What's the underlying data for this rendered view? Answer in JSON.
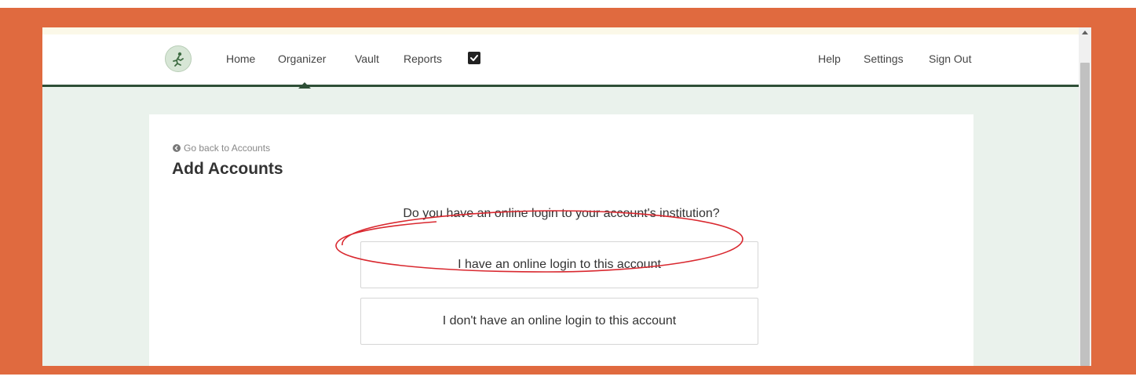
{
  "nav": {
    "left_items": [
      "Home",
      "Organizer",
      "Vault",
      "Reports"
    ],
    "right_items": [
      "Help",
      "Settings",
      "Sign Out"
    ],
    "active_item": "Organizer",
    "tasks_icon": "checkbox-icon",
    "logo_icon": "runner-logo-icon"
  },
  "page": {
    "back_link": "Go back to Accounts",
    "title": "Add Accounts",
    "question": "Do you have an online login to your account's institution?"
  },
  "options": {
    "has_login": "I have an online login to this account",
    "no_login": "I don't have an online login to this account"
  },
  "colors": {
    "frame": "#e06a3f",
    "nav_border": "#2e4f36",
    "page_background": "#eaf2ec",
    "annotation": "#d9282f"
  }
}
